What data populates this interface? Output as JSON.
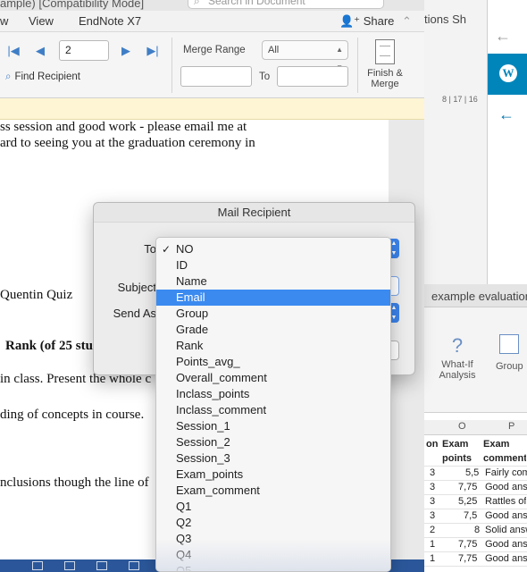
{
  "word": {
    "title_fragment": "ample) [Compatibility Mode]",
    "search_placeholder": "Search in Document",
    "menu": {
      "view": "View",
      "endnote": "EndNote X7",
      "share": "Share"
    },
    "ribbon": {
      "record_number": "2",
      "find_recipient": "Find Recipient",
      "merge_range_label": "Merge Range",
      "merge_range_value": "All",
      "to_label": "To",
      "finish_merge": "Finish &\nMerge"
    },
    "document_lines": [
      "ss session and good work - please email me at",
      "ard to seeing you at the graduation ceremony in",
      "Quentin Quiz",
      "Rank (of 25 stu",
      "in class. Present the whole c",
      "ding of concepts in course.",
      "nclusions though the line of"
    ]
  },
  "strip": {
    "tabs": "tions   Sh",
    "ruler": "8 | 17 | 16"
  },
  "excel": {
    "title_fragment": "example evaluation",
    "what_if": "What-If\nAnalysis",
    "group_label": "Group",
    "col_o": "O",
    "col_p": "P",
    "header_n": "on",
    "header_o": "Exam points",
    "header_p": "Exam comment",
    "rows": [
      {
        "n": "3",
        "o": "5,5",
        "p": "Fairly com"
      },
      {
        "n": "3",
        "o": "7,75",
        "p": "Good answ"
      },
      {
        "n": "3",
        "o": "5,25",
        "p": "Rattles of"
      },
      {
        "n": "3",
        "o": "7,5",
        "p": "Good answ"
      },
      {
        "n": "2",
        "o": "8",
        "p": "Solid answ"
      },
      {
        "n": "1",
        "o": "7,75",
        "p": "Good answ"
      },
      {
        "n": "1",
        "o": "7,75",
        "p": "Good answ"
      }
    ]
  },
  "dialog": {
    "title": "Mail Recipient",
    "to_label": "To",
    "subject_label": "Subject",
    "send_as_label": "Send As"
  },
  "dropdown": {
    "items": [
      {
        "label": "NO",
        "checked": true
      },
      {
        "label": "ID"
      },
      {
        "label": "Name"
      },
      {
        "label": "Email",
        "selected": true
      },
      {
        "label": "Group"
      },
      {
        "label": "Grade"
      },
      {
        "label": "Rank"
      },
      {
        "label": "Points_avg_"
      },
      {
        "label": "Overall_comment"
      },
      {
        "label": "Inclass_points"
      },
      {
        "label": "Inclass_comment"
      },
      {
        "label": "Session_1"
      },
      {
        "label": "Session_2"
      },
      {
        "label": "Session_3"
      },
      {
        "label": "Exam_points"
      },
      {
        "label": "Exam_comment"
      },
      {
        "label": "Q1"
      },
      {
        "label": "Q2"
      },
      {
        "label": "Q3"
      },
      {
        "label": "Q4"
      },
      {
        "label": "Q5"
      }
    ],
    "check_glyph": "✓"
  },
  "colors": {
    "accent": "#3b8af0",
    "word_blue": "#2b579a",
    "wp_blue": "#0085ba"
  }
}
